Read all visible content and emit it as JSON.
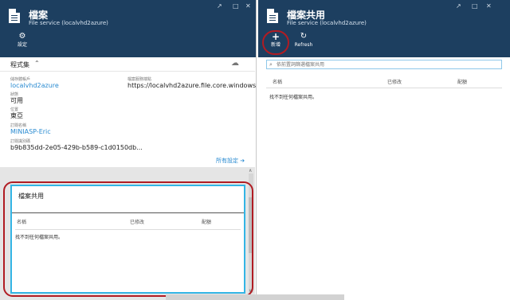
{
  "left_blade": {
    "title": "檔案",
    "subtitle": "File service (localvhd2azure)",
    "commands": [
      {
        "label": "設定",
        "icon": "gear-icon"
      }
    ],
    "essentials": {
      "title": "程式集",
      "properties": [
        {
          "label": "儲存體帳戶",
          "value": "localvhd2azure",
          "link": true
        },
        {
          "label": "狀態",
          "value": "可用",
          "link": false
        },
        {
          "label": "位置",
          "value": "東亞",
          "link": false
        },
        {
          "label": "訂閱名稱",
          "value": "MINIASP-Eric",
          "link": true
        },
        {
          "label": "訂閱識別碼",
          "value": "b9b835dd-2e05-429b-b589-c1d0150db...",
          "link": false
        }
      ],
      "endpoint": {
        "label": "檔案服務端點",
        "value": "https://localvhd2azure.file.core.windows..."
      },
      "all_settings": "所有設定 ➔"
    },
    "tile": {
      "title": "檔案共用",
      "columns": [
        "名稱",
        "已修改",
        "配額"
      ],
      "empty_message": "找不到任何檔案共用。"
    }
  },
  "right_blade": {
    "title": "檔案共用",
    "subtitle": "File service (localvhd2azure)",
    "commands": [
      {
        "label": "新增",
        "icon": "plus-icon"
      },
      {
        "label": "Refresh",
        "icon": "refresh-icon"
      }
    ],
    "search_placeholder": "依前置詞篩選檔案共用",
    "columns": [
      "名稱",
      "已修改",
      "配額"
    ],
    "empty_message": "找不到任何檔案共用。"
  },
  "colors": {
    "header_bg": "#1d3f60",
    "link": "#2a8bd1",
    "tile_border": "#33b5e5",
    "highlight": "#b01c23"
  }
}
